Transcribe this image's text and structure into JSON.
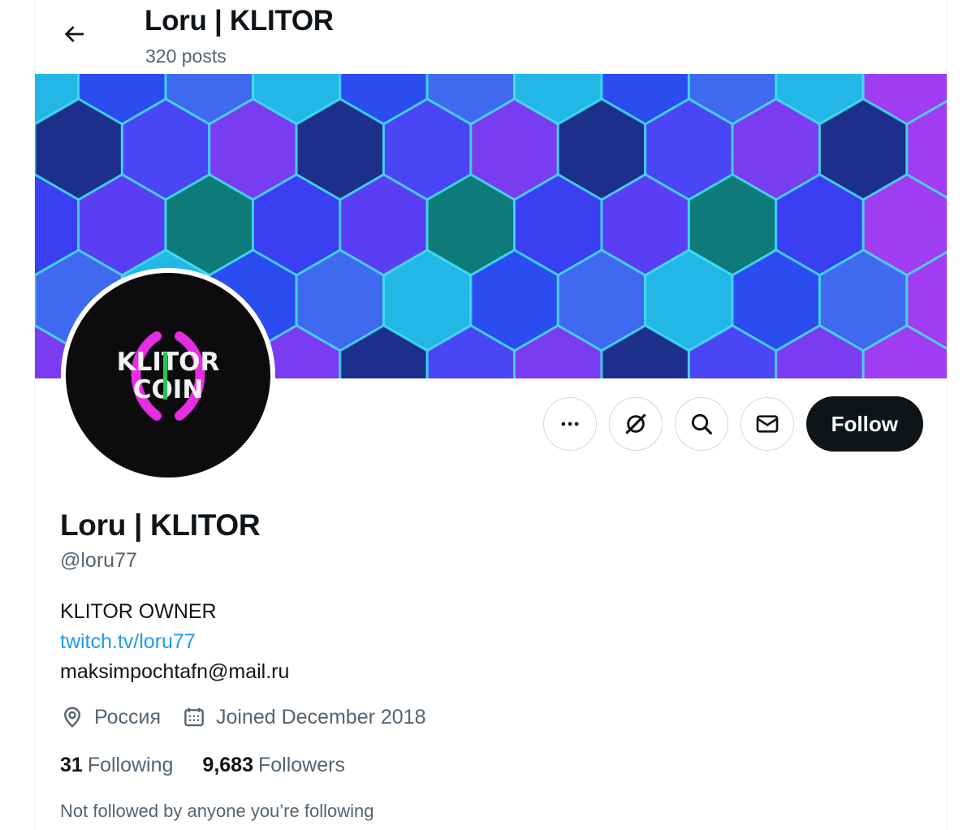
{
  "header": {
    "title": "Loru | KLITOR",
    "posts_count": "320 posts"
  },
  "avatar": {
    "line1": "KLITOR",
    "line2": "COIN"
  },
  "actions": {
    "more_icon": "more-horizontal-icon",
    "grok_icon": "grok-icon",
    "search_icon": "search-icon",
    "message_icon": "envelope-icon",
    "follow_label": "Follow"
  },
  "profile": {
    "name": "Loru | KLITOR",
    "handle": "@loru77",
    "bio_line1": "KLITOR OWNER",
    "bio_link": "twitch.tv/loru77",
    "bio_line3": "maksimpochtafn@mail.ru",
    "location": "Россия",
    "joined": "Joined December 2018",
    "following_count": "31",
    "following_label": "Following",
    "followers_count": "9,683",
    "followers_label": "Followers",
    "not_followed": "Not followed by anyone you’re following"
  },
  "colors": {
    "link": "#1d9bf0",
    "primary_text": "#0f1419",
    "secondary_text": "#536471",
    "follow_button": "#0f1419"
  }
}
